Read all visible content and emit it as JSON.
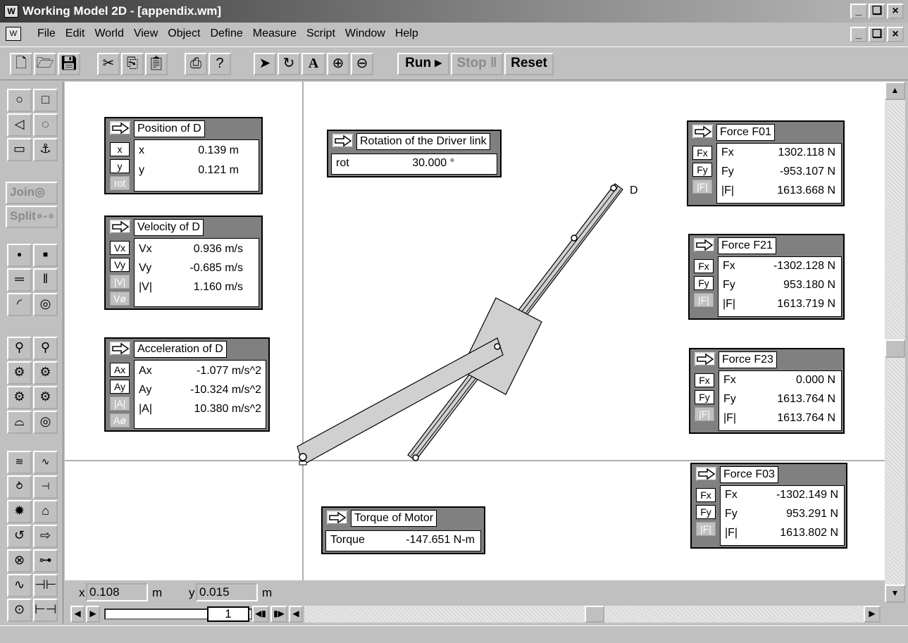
{
  "window": {
    "title": "Working Model 2D - [appendix.wm]",
    "min": "_",
    "max": "❑",
    "close": "×"
  },
  "menu": [
    "File",
    "Edit",
    "World",
    "View",
    "Object",
    "Define",
    "Measure",
    "Script",
    "Window",
    "Help"
  ],
  "toolbar": {
    "run": "Run ▸",
    "stop": "Stop ‖",
    "reset": "Reset"
  },
  "palette": {
    "join": "Join◎",
    "split": "Split∘-∘"
  },
  "meters": {
    "position": {
      "title": "Position of D",
      "buttons": [
        "x",
        "y",
        "rot"
      ],
      "rows": [
        {
          "label": "x",
          "value": "0.139 m"
        },
        {
          "label": "y",
          "value": "0.121 m"
        }
      ]
    },
    "velocity": {
      "title": "Velocity of D",
      "buttons": [
        "Vx",
        "Vy",
        "|V|",
        "Vø"
      ],
      "rows": [
        {
          "label": "Vx",
          "value": "0.936 m/s"
        },
        {
          "label": "Vy",
          "value": "-0.685 m/s"
        },
        {
          "label": "|V|",
          "value": "1.160 m/s"
        }
      ]
    },
    "acceleration": {
      "title": "Acceleration of D",
      "buttons": [
        "Ax",
        "Ay",
        "|A|",
        "Aø"
      ],
      "rows": [
        {
          "label": "Ax",
          "value": "-1.077 m/s^2"
        },
        {
          "label": "Ay",
          "value": "-10.324 m/s^2"
        },
        {
          "label": "|A|",
          "value": "10.380 m/s^2"
        }
      ]
    },
    "rotation": {
      "title": "Rotation of the Driver link",
      "rows": [
        {
          "label": "rot",
          "value": "30.000 °"
        }
      ]
    },
    "torque": {
      "title": "Torque of Motor",
      "rows": [
        {
          "label": "Torque",
          "value": "-147.651 N-m"
        }
      ]
    },
    "f01": {
      "title": "Force F01",
      "buttons": [
        "Fx",
        "Fy",
        "|F|"
      ],
      "rows": [
        {
          "label": "Fx",
          "value": "1302.118 N"
        },
        {
          "label": "Fy",
          "value": "-953.107 N"
        },
        {
          "label": "|F|",
          "value": "1613.668 N"
        }
      ]
    },
    "f21": {
      "title": "Force F21",
      "buttons": [
        "Fx",
        "Fy",
        "|F|"
      ],
      "rows": [
        {
          "label": "Fx",
          "value": "-1302.128 N"
        },
        {
          "label": "Fy",
          "value": "953.180 N"
        },
        {
          "label": "|F|",
          "value": "1613.719 N"
        }
      ]
    },
    "f23": {
      "title": "Force F23",
      "buttons": [
        "Fx",
        "Fy",
        "|F|"
      ],
      "rows": [
        {
          "label": "Fx",
          "value": "0.000 N"
        },
        {
          "label": "Fy",
          "value": "1613.764 N"
        },
        {
          "label": "|F|",
          "value": "1613.764 N"
        }
      ]
    },
    "f03": {
      "title": "Force F03",
      "buttons": [
        "Fx",
        "Fy",
        "|F|"
      ],
      "rows": [
        {
          "label": "Fx",
          "value": "-1302.149 N"
        },
        {
          "label": "Fy",
          "value": "953.291 N"
        },
        {
          "label": "|F|",
          "value": "1613.802 N"
        }
      ]
    }
  },
  "scene": {
    "point_label": "D"
  },
  "coords": {
    "x_label": "x",
    "x_value": "0.108",
    "x_unit": "m",
    "y_label": "y",
    "y_value": "0.015",
    "y_unit": "m"
  },
  "playback": {
    "frame": "1"
  }
}
